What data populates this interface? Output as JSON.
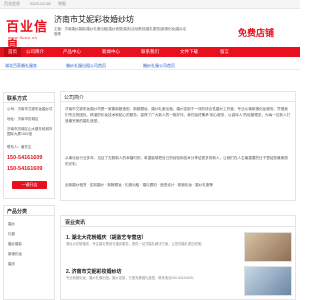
{
  "topbar": {
    "left_text": "百业信息",
    "date": "2023-02-28",
    "report": "举报"
  },
  "logo": {
    "main": "百业信息",
    "sub": "www.3uuu.cn"
  },
  "header": {
    "title": "济南市艾妮彩妆婚纱坊",
    "tagline": "主营：济南婚纱摄影|婚纱礼服出租|婚纱造型|婚庆|活动策划|婚礼跟拍|新娘化妆|婚纱定做等",
    "free_shop": "免费店铺"
  },
  "nav": {
    "items": [
      "首页",
      "公司简介",
      "产品中心",
      "新闻中心",
      "联系我们",
      "文件下载",
      "留言"
    ]
  },
  "breadcrumb": {
    "items": [
      "湖北百家婚礼服务",
      "婚纱礼服出租公司首页",
      "婚纱礼服公司首页"
    ]
  },
  "contact": {
    "title": "联系方式",
    "rows": [
      "公司：济南市艾妮彩妆婚纱坊",
      "地址：济南市历城区",
      "济南市历城区山大路东段城市国际大厦1502室",
      "联系人：姜先生"
    ],
    "phone1": "150-54161609",
    "phone2": "150-54161609",
    "button": "一键开店"
  },
  "products": {
    "title": "产品分类",
    "items": [
      "婚纱",
      "礼服",
      "婚纱摄影",
      "新娘化妆",
      "婚庆"
    ]
  },
  "intro": {
    "title": "公司简介",
    "paragraphs": [
      "济南市艾妮彩妆婚纱坊是一家集新娘造型、新娘跟妆、婚纱礼服出租、婚纱定制于一体的综合性婚纱工作室，专业从事新娘化妆服务。凭借我们专业的团队、精湛的化妆技术和贴心的服务，赢得了广大新人的一致好评。我们始终秉承“用心服务，以诚待人”的经营理念，为每一位新人打造最完美的婚礼造型。",
      "从事化妆行业多年，见证了无数新人的幸福时刻，希望能够把自己的经验和技术分享给更多的新人，让她们在人生最重要的日子里绽放最美丽的光彩。",
      "全新婚纱租赁 · 定制婚纱 · 新娘跟妆 · 礼服出租 · 婚礼跟拍 · 造型设计 · 新娘化妆 · 婚纱礼服等"
    ]
  },
  "news": {
    "title": "百业资讯",
    "items": [
      {
        "title": "1. 湖北大花轿婚庆（胡蓝艺专营店）",
        "desc": "湖北大花轿婚庆，专注婚礼策划与婚庆服务，提供一站式婚礼解决方案，让您的婚礼更加完美。"
      },
      {
        "title": "2. 济南市艾妮彩妆婚纱坊",
        "desc": "专业新娘化妆、婚纱礼服出租、婚纱定制，打造完美婚礼造型，联系电话150-54161609。"
      }
    ]
  },
  "colors": {
    "brand": "#e8101c",
    "link": "#1a5cc8"
  }
}
